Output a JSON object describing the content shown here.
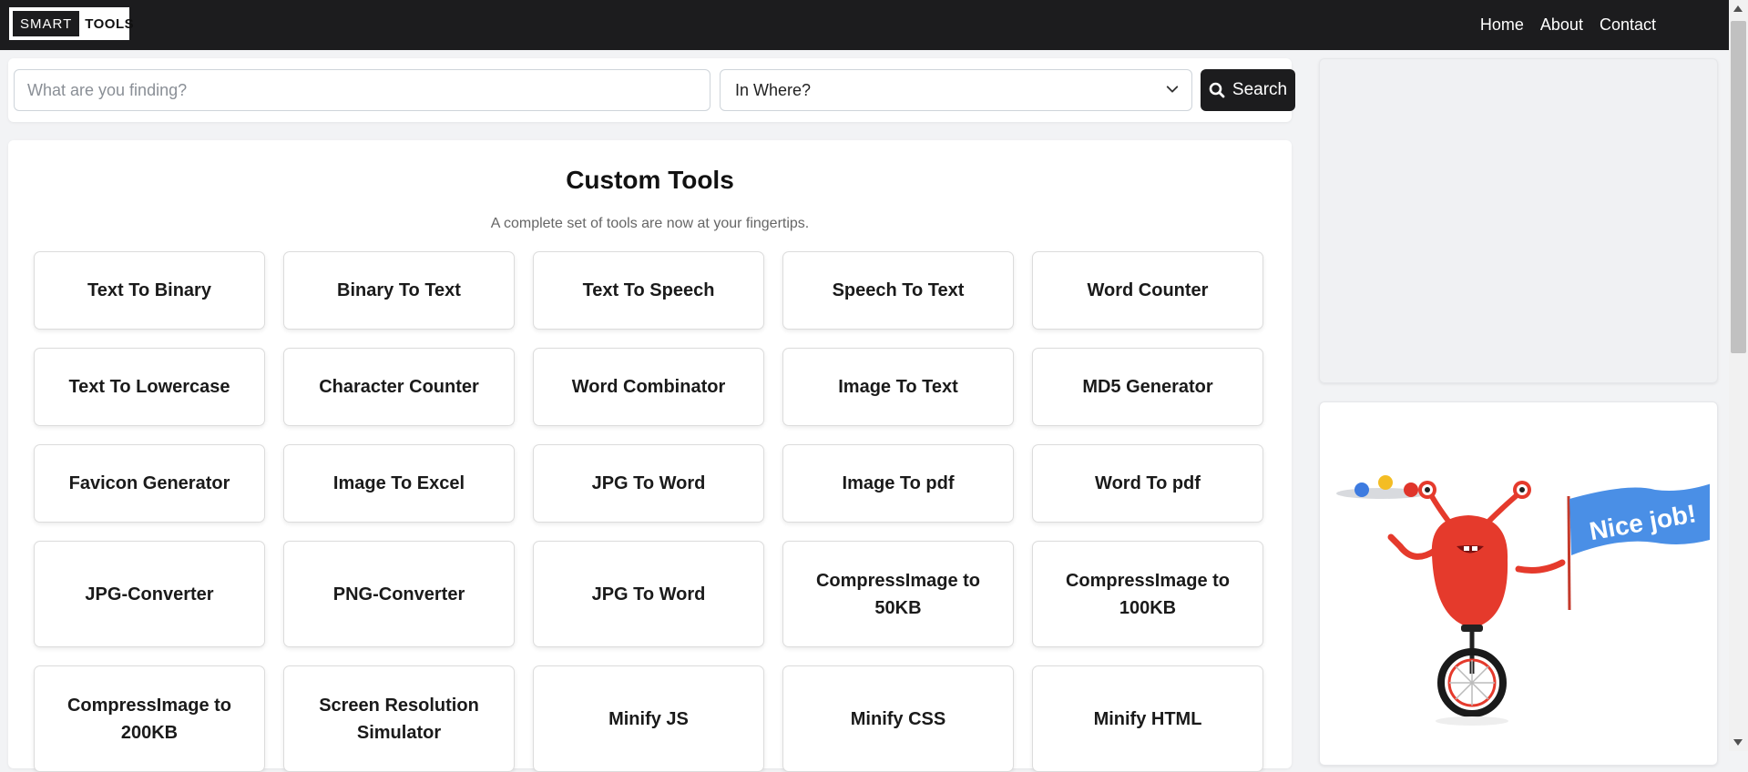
{
  "logo": {
    "part1": "SMART",
    "part2": "TOOLS"
  },
  "nav": {
    "home": "Home",
    "about": "About",
    "contact": "Contact"
  },
  "search": {
    "placeholder": "What are you finding?",
    "value": "",
    "select_value": "In Where?",
    "button_label": "Search"
  },
  "tools": {
    "title": "Custom Tools",
    "subtitle": "A complete set of tools are now at your fingertips.",
    "items": [
      "Text To Binary",
      "Binary To Text",
      "Text To Speech",
      "Speech To Text",
      "Word Counter",
      "Text To Lowercase",
      "Character Counter",
      "Word Combinator",
      "Image To Text",
      "MD5 Generator",
      "Favicon Generator",
      "Image To Excel",
      "JPG To Word",
      "Image To pdf",
      "Word To pdf",
      "JPG-Converter",
      "PNG-Converter",
      "JPG To Word",
      "CompressImage to 50KB",
      "CompressImage to 100KB",
      "CompressImage to 200KB",
      "Screen Resolution Simulator",
      "Minify JS",
      "Minify CSS",
      "Minify HTML"
    ]
  },
  "sidebar_image": {
    "banner_text": "Nice job!"
  },
  "colors": {
    "navbar": "#1c1c1e",
    "page_bg": "#f2f3f5",
    "accent": "#1c1c1e",
    "banner": "#4a8fe6",
    "monster": "#e53a2c"
  }
}
